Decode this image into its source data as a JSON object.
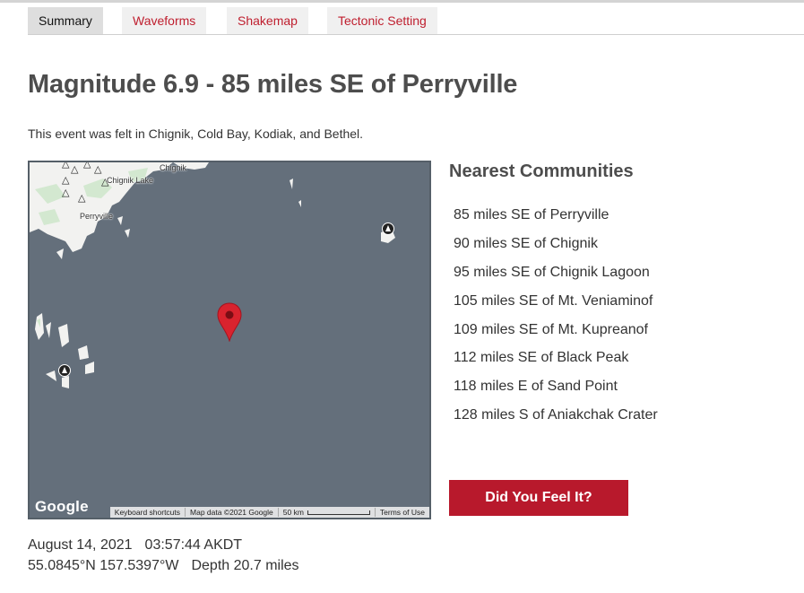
{
  "tabs": [
    {
      "label": "Summary",
      "active": true
    },
    {
      "label": "Waveforms",
      "active": false
    },
    {
      "label": "Shakemap",
      "active": false
    },
    {
      "label": "Tectonic Setting",
      "active": false
    }
  ],
  "title": "Magnitude 6.9 - 85 miles SE of Perryville",
  "felt_text": "This event was felt in Chignik, Cold Bay, Kodiak, and Bethel.",
  "map": {
    "place_labels": [
      "Chignik",
      "Chignik Lake",
      "Perryville"
    ],
    "icons": [
      "volcano-triangle-icon",
      "volcano-badge-icon",
      "epicenter-pin-icon"
    ],
    "google_logo": "Google",
    "attribution": {
      "shortcuts": "Keyboard shortcuts",
      "map_data": "Map data ©2021 Google",
      "scale": "50 km",
      "terms": "Terms of Use"
    },
    "colors": {
      "water": "#646f7b",
      "land": "#f2f2f0",
      "pin": "#d9232e"
    }
  },
  "nearest": {
    "title": "Nearest Communities",
    "items": [
      "85 miles SE of Perryville",
      "90 miles SE of Chignik",
      "95 miles SE of Chignik Lagoon",
      "105 miles SE of Mt. Veniaminof",
      "109 miles SE of Mt. Kupreanof",
      "112 miles SE of Black Peak",
      "118 miles E of Sand Point",
      "128 miles S of Aniakchak Crater"
    ]
  },
  "dyfi_button": "Did You Feel It?",
  "event": {
    "date": "August 14, 2021",
    "time": "03:57:44 AKDT",
    "coords": "55.0845°N 157.5397°W",
    "depth": "Depth 20.7 miles"
  },
  "colors": {
    "accent": "#bf1e2e",
    "button": "#b8192c"
  }
}
